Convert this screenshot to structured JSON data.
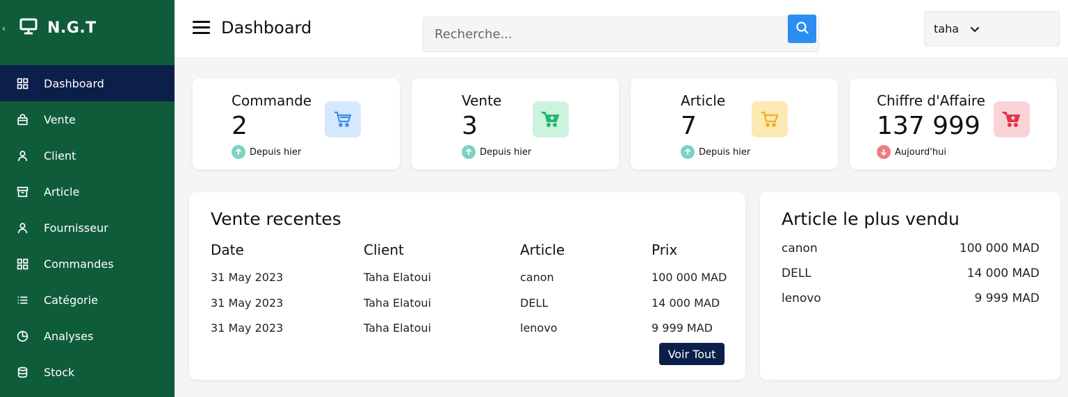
{
  "app": {
    "brand": "N.G.T"
  },
  "sidebar": {
    "items": [
      {
        "label": "Dashboard",
        "icon": "grid-icon",
        "active": true
      },
      {
        "label": "Vente",
        "icon": "shopping-bag-icon"
      },
      {
        "label": "Client",
        "icon": "user-icon"
      },
      {
        "label": "Article",
        "icon": "archive-icon"
      },
      {
        "label": "Fournisseur",
        "icon": "user-icon"
      },
      {
        "label": "Commandes",
        "icon": "grid-icon"
      },
      {
        "label": "Catégorie",
        "icon": "list-icon"
      },
      {
        "label": "Analyses",
        "icon": "pie-chart-icon"
      },
      {
        "label": "Stock",
        "icon": "database-icon"
      }
    ]
  },
  "header": {
    "title": "Dashboard",
    "search_placeholder": "Recherche...",
    "user": "taha"
  },
  "stats": [
    {
      "label": "Commande",
      "value": "2",
      "trend": "Depuis hier",
      "direction": "up",
      "icon": "cart-icon",
      "color": "#3d8ff0",
      "bg": "#d6e8fd"
    },
    {
      "label": "Vente",
      "value": "3",
      "trend": "Depuis hier",
      "direction": "up",
      "icon": "cart-plus-icon",
      "color": "#27b46c",
      "bg": "#cdf3de"
    },
    {
      "label": "Article",
      "value": "7",
      "trend": "Depuis hier",
      "direction": "up",
      "icon": "cart-icon",
      "color": "#f0ad1e",
      "bg": "#fde9b4"
    },
    {
      "label": "Chiffre d'Affaire",
      "value": "137 999",
      "trend": "Aujourd'hui",
      "direction": "down",
      "icon": "cart-plus-icon",
      "color": "#e0334d",
      "bg": "#f9d3d8"
    }
  ],
  "colors": {
    "trend_up": "#7dd3c0",
    "trend_down": "#f07a85",
    "sidebar_bg": "#0f5c3a",
    "sidebar_active": "#0b1f4a",
    "search_button": "#2c8ef0"
  },
  "recent_sales": {
    "title": "Vente recentes",
    "columns": [
      "Date",
      "Client",
      "Article",
      "Prix"
    ],
    "rows": [
      [
        "31 May 2023",
        "Taha Elatoui",
        "canon",
        "100 000 MAD"
      ],
      [
        "31 May 2023",
        "Taha Elatoui",
        "DELL",
        "14 000 MAD"
      ],
      [
        "31 May 2023",
        "Taha Elatoui",
        "lenovo",
        "9 999 MAD"
      ]
    ],
    "button": "Voir Tout"
  },
  "best_selling": {
    "title": "Article le plus vendu",
    "items": [
      {
        "name": "canon",
        "value": "100 000 MAD"
      },
      {
        "name": "DELL",
        "value": "14 000 MAD"
      },
      {
        "name": "lenovo",
        "value": "9 999 MAD"
      }
    ]
  }
}
